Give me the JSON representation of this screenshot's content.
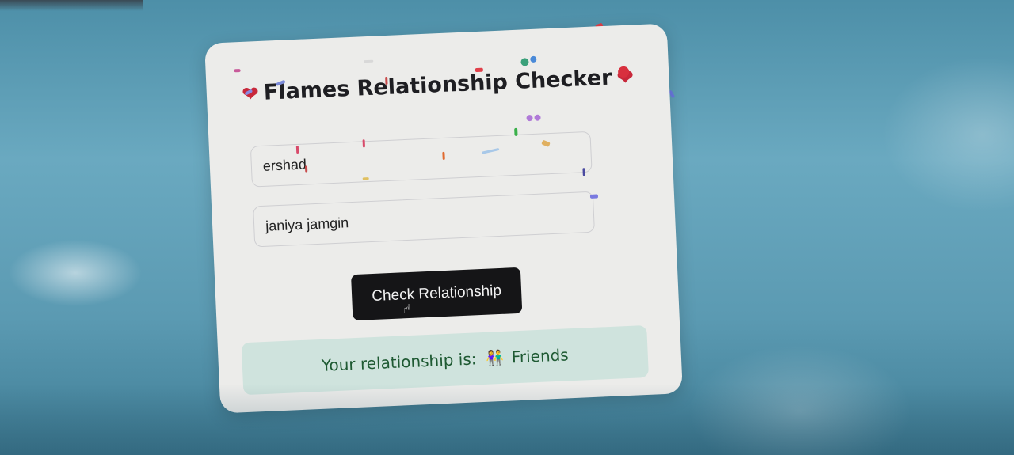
{
  "app": {
    "title": "Flames Relationship Checker",
    "title_icon": "heart-icon"
  },
  "form": {
    "name1_value": "ershad",
    "name2_value": "janiya jamgin",
    "button_label": "Check Relationship"
  },
  "result": {
    "label": "Your relationship is:",
    "icon": "friends-icon",
    "value": "Friends"
  },
  "colors": {
    "card_background": "#ececea",
    "button_background": "#151517",
    "result_background": "#cfe3dd",
    "result_text": "#1f5a33",
    "heart": "#c8283a"
  }
}
